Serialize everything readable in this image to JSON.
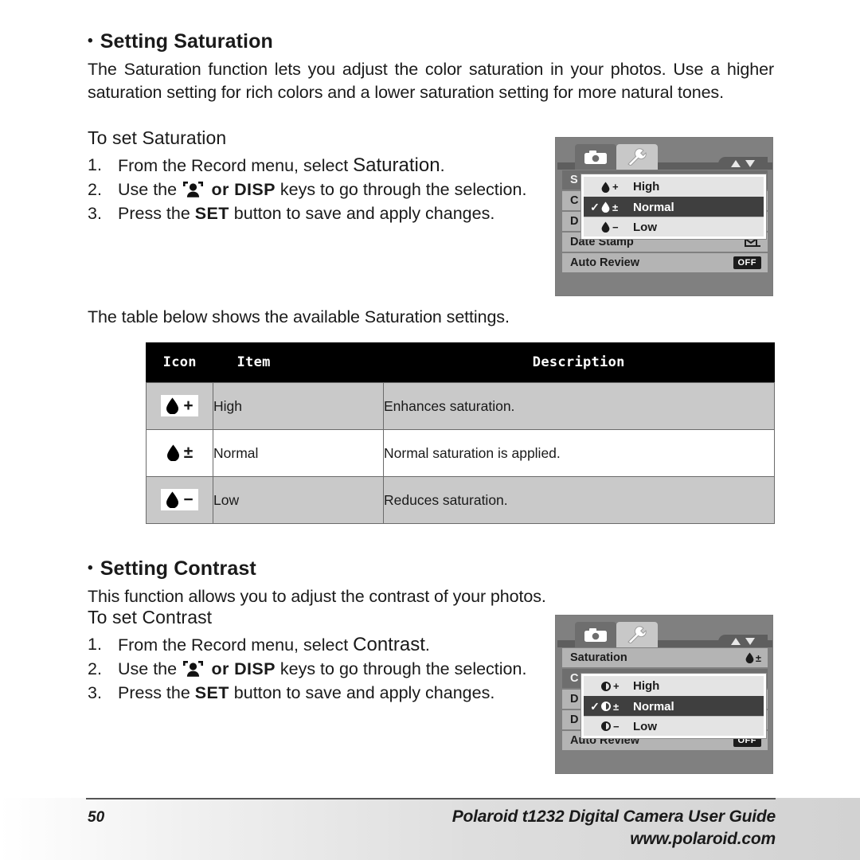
{
  "saturation_section": {
    "heading": "Setting Saturation",
    "bullet": "•",
    "intro": "The Saturation function lets you adjust the color saturation in your photos. Use a higher saturation setting for rich colors and a lower saturation setting for more natural tones.",
    "subheading": "To set Saturation",
    "steps": [
      {
        "num": "1.",
        "pre": "From the Record menu, select ",
        "emph": "Saturation",
        "post": "."
      },
      {
        "num": "2.",
        "pre": "Use the ",
        "icon": "face-detection-icon",
        "mid": " or ",
        "kbd": "DISP",
        "post": " keys to go through the selection."
      },
      {
        "num": "3.",
        "pre": "Press the ",
        "kbd": "SET",
        "post": " button to save and apply changes."
      }
    ],
    "table_intro": "The table below shows the available Saturation settings."
  },
  "table": {
    "headers": [
      "Icon",
      "Item",
      "Description"
    ],
    "rows": [
      {
        "icon_glyph": "droplet",
        "sign": "+",
        "item": "High",
        "description": "Enhances saturation."
      },
      {
        "icon_glyph": "droplet",
        "sign": "±",
        "item": "Normal",
        "description": "Normal saturation is applied."
      },
      {
        "icon_glyph": "droplet",
        "sign": "−",
        "item": "Low",
        "description": "Reduces saturation."
      }
    ]
  },
  "contrast_section": {
    "heading": "Setting Contrast",
    "bullet": "•",
    "intro": "This function allows you to adjust the contrast of your photos.",
    "subheading": "To set Contrast",
    "steps": [
      {
        "num": "1.",
        "pre": "From the Record menu, select ",
        "emph": "Contrast",
        "post": "."
      },
      {
        "num": "2.",
        "pre": "Use the ",
        "icon": "face-detection-icon",
        "mid": " or ",
        "kbd": "DISP",
        "post": " keys to go through the selection."
      },
      {
        "num": "3.",
        "pre": "Press the ",
        "kbd": "SET",
        "post": " button to save and apply changes."
      }
    ]
  },
  "lcd_saturation": {
    "tabs": [
      {
        "name": "camera-tab",
        "state": "active"
      },
      {
        "name": "setup-tab",
        "state": "inactive"
      }
    ],
    "menu_rows": [
      {
        "label": "S",
        "value": "",
        "selected": true
      },
      {
        "label": "C",
        "value": "",
        "selected": false
      },
      {
        "label": "D",
        "value": "",
        "selected": false
      },
      {
        "label": "Date Stamp",
        "value": "date-icon",
        "selected": false
      },
      {
        "label": "Auto Review",
        "value": "OFF",
        "selected": false
      }
    ],
    "popup": {
      "options": [
        {
          "icon": "droplet",
          "sign": "+",
          "label": "High",
          "checked": false
        },
        {
          "icon": "droplet",
          "sign": "±",
          "label": "Normal",
          "checked": true
        },
        {
          "icon": "droplet",
          "sign": "−",
          "label": "Low",
          "checked": false
        }
      ],
      "check_glyph": "✓"
    }
  },
  "lcd_contrast": {
    "tabs": [
      {
        "name": "camera-tab",
        "state": "active"
      },
      {
        "name": "setup-tab",
        "state": "inactive"
      }
    ],
    "menu_rows": [
      {
        "label": "Saturation",
        "value": "droplet-pm",
        "selected": false
      },
      {
        "label": "C",
        "value": "",
        "selected": true
      },
      {
        "label": "D",
        "value": "",
        "selected": false
      },
      {
        "label": "D",
        "value": "",
        "selected": false
      },
      {
        "label": "Auto Review",
        "value": "OFF",
        "selected": false
      }
    ],
    "popup": {
      "options": [
        {
          "icon": "contrast",
          "sign": "+",
          "label": "High",
          "checked": false
        },
        {
          "icon": "contrast",
          "sign": "±",
          "label": "Normal",
          "checked": true
        },
        {
          "icon": "contrast",
          "sign": "−",
          "label": "Low",
          "checked": false
        }
      ],
      "check_glyph": "✓"
    }
  },
  "footer": {
    "page_number": "50",
    "title": "Polaroid t1232 Digital Camera User Guide",
    "url": "www.polaroid.com"
  }
}
